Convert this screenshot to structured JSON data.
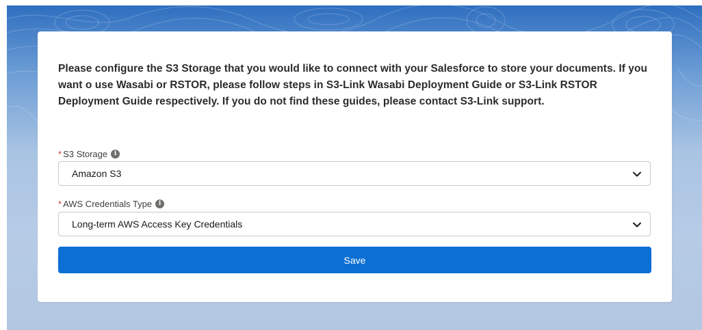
{
  "intro_text": "Please configure the S3 Storage that you would like to connect with your Salesforce to store your documents. If you want o use Wasabi or RSTOR, please follow steps in S3-Link Wasabi Deployment Guide or S3-Link RSTOR Deployment Guide respectively. If you do not find these guides, please contact S3-Link support.",
  "fields": {
    "storage": {
      "required_mark": "*",
      "label": "S3 Storage",
      "value": "Amazon S3",
      "info_icon": "i"
    },
    "credentials": {
      "required_mark": "*",
      "label": "AWS Credentials Type",
      "value": "Long-term AWS Access Key Credentials",
      "info_icon": "i"
    }
  },
  "save_label": "Save",
  "colors": {
    "primary_button": "#0b6fd3",
    "required": "#c23934",
    "background_top": "#2f6fc0",
    "background_bottom": "#b3c7e2"
  },
  "icons": {
    "info": "info-icon",
    "dropdown": "chevron-down-icon"
  }
}
